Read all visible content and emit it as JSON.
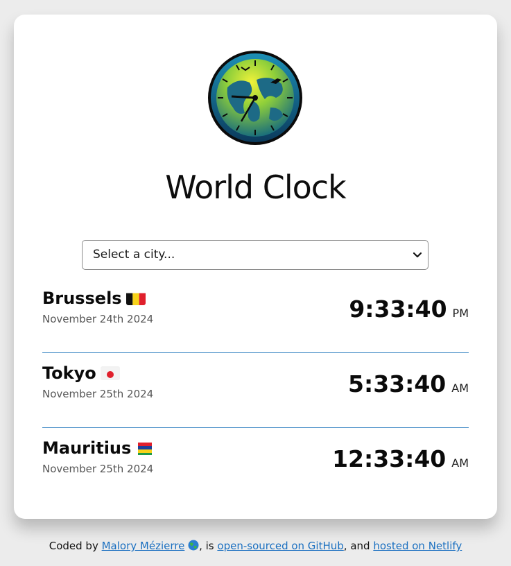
{
  "app": {
    "title": "World Clock"
  },
  "select": {
    "selected": "Select a city..."
  },
  "cities": [
    {
      "name": "Brussels",
      "flag": "belgium-flag-icon",
      "date": "November 24th 2024",
      "time": "9:33:40",
      "ampm": "PM"
    },
    {
      "name": "Tokyo",
      "flag": "japan-flag-icon",
      "date": "November 25th 2024",
      "time": "5:33:40",
      "ampm": "AM"
    },
    {
      "name": "Mauritius",
      "flag": "mauritius-flag-icon",
      "date": "November 25th 2024",
      "time": "12:33:40",
      "ampm": "AM"
    }
  ],
  "footer": {
    "prefix": "Coded by",
    "author": "Malory Mézierre",
    "mid1": ", is",
    "github_link": "open-sourced on GitHub",
    "mid2": ", and",
    "netlify_link": "hosted on Netlify"
  },
  "colors": {
    "accent": "#4a90c8",
    "link": "#1a6fc0",
    "background": "#ececec"
  }
}
